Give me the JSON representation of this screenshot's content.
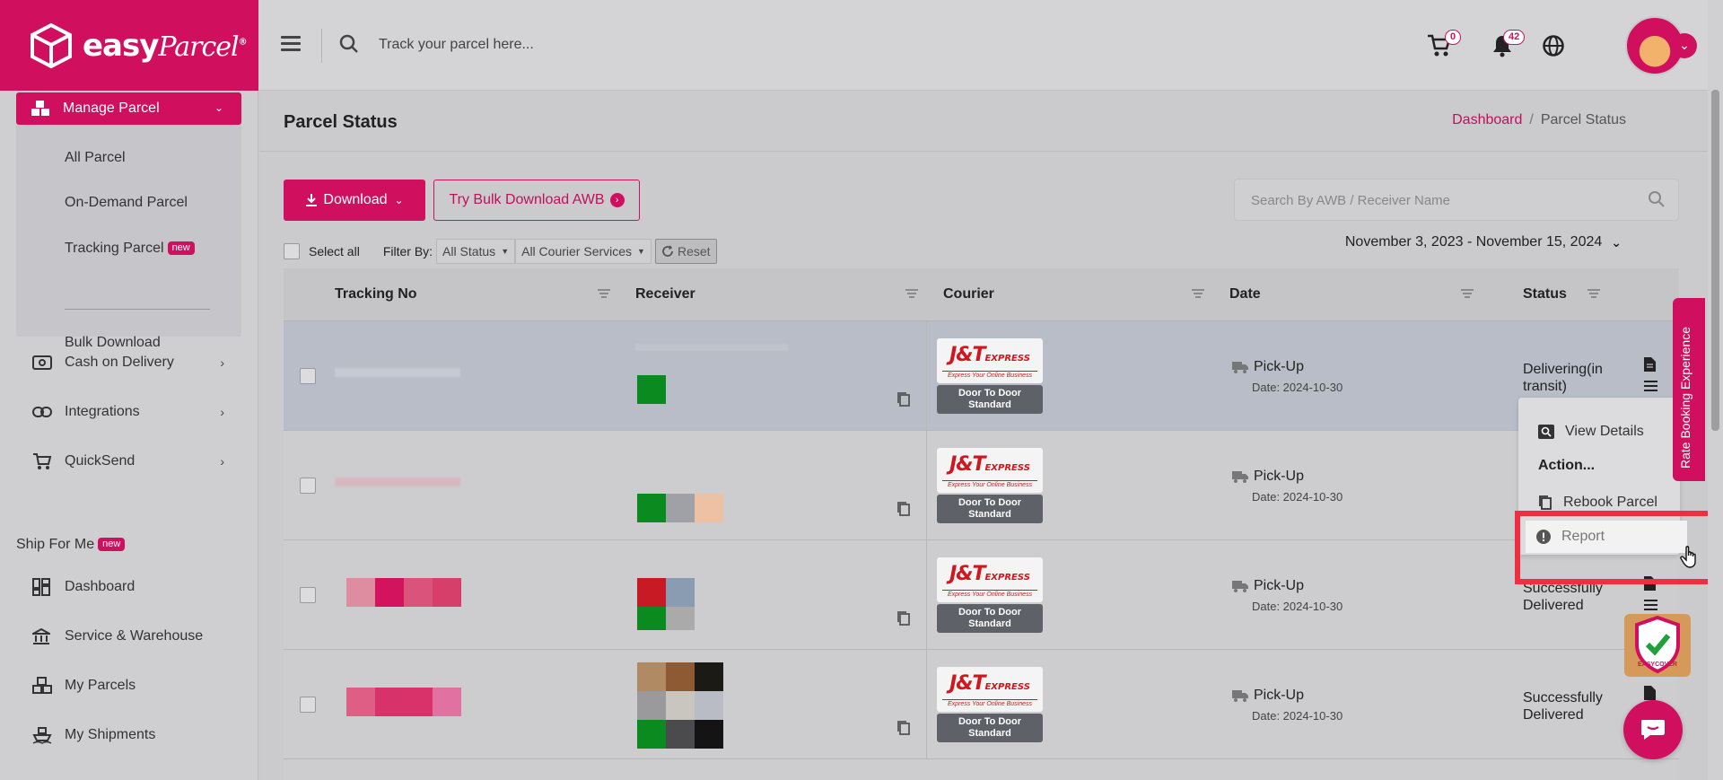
{
  "brand": {
    "name": "easy",
    "name_script": "Parcel",
    "reg": "®"
  },
  "topbar": {
    "search_placeholder": "Track your parcel here...",
    "cart_count": "0",
    "notification_count": "42"
  },
  "sidebar": {
    "active_menu": "Manage Parcel",
    "sub_items": [
      "All Parcel",
      "On-Demand Parcel",
      "Tracking Parcel",
      "Bulk Download"
    ],
    "new_badge": "new",
    "items": [
      "Cash on Delivery",
      "Integrations",
      "QuickSend"
    ],
    "section_title": "Ship For Me",
    "section_items": [
      "Dashboard",
      "Service & Warehouse",
      "My Parcels",
      "My Shipments"
    ]
  },
  "page": {
    "title": "Parcel Status",
    "breadcrumb_home": "Dashboard",
    "breadcrumb_sep": "/",
    "breadcrumb_current": "Parcel Status"
  },
  "toolbar": {
    "download_label": "Download",
    "bulk_label": "Try Bulk Download AWB",
    "awb_placeholder": "Search By AWB / Receiver Name",
    "select_all": "Select all",
    "filter_by": "Filter By:",
    "status_filter": "All Status",
    "courier_filter": "All Courier Services",
    "reset": "Reset",
    "date_range": "November 3, 2023 - November 15, 2024"
  },
  "table": {
    "headers": [
      "Tracking No",
      "Receiver",
      "Courier",
      "Date",
      "Status"
    ],
    "rows": [
      {
        "courier": "J&T",
        "service": "Door To Door Standard",
        "pickup": "Pick-Up",
        "date": "Date: 2024-10-30",
        "status": "Delivering(in transit)"
      },
      {
        "courier": "J&T",
        "service": "Door To Door Standard",
        "pickup": "Pick-Up",
        "date": "Date: 2024-10-30",
        "status": ""
      },
      {
        "courier": "J&T",
        "service": "Door To Door Standard",
        "pickup": "Pick-Up",
        "date": "Date: 2024-10-30",
        "status": "Successfully Delivered"
      },
      {
        "courier": "J&T",
        "service": "Door To Door Standard",
        "pickup": "Pick-Up",
        "date": "Date: 2024-10-30",
        "status": "Successfully Delivered"
      }
    ],
    "courier_logo_main": "J&T",
    "courier_logo_sub": "EXPRESS",
    "courier_tagline": "Express Your Online Business"
  },
  "dropdown": {
    "view_details": "View Details",
    "action_header": "Action...",
    "rebook": "Rebook Parcel",
    "report": "Report"
  },
  "floating": {
    "rate_tab": "Rate Booking Experience",
    "easycover_label": "EASYCOVER"
  },
  "colors": {
    "brand": "#d0105f",
    "highlight": "#ef2f3f",
    "courier_red": "#d2161f"
  }
}
